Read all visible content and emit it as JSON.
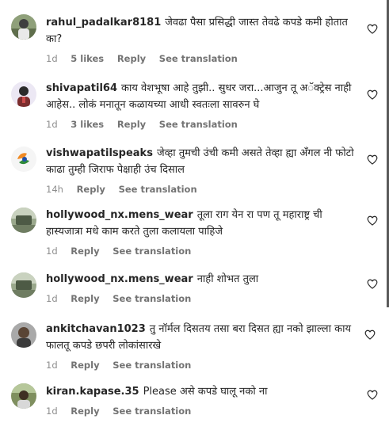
{
  "comments": [
    {
      "username": "rahul_padalkar8181",
      "text": "जेवढा पैसा प्रसिद्धी जास्त तेवढे कपडे कमी होतात का?",
      "time": "1d",
      "likes": "5 likes",
      "reply": "Reply",
      "translate": "See translation",
      "avatar_color": "#6b7b5a"
    },
    {
      "username": "shivapatil64",
      "text": "काय वेशभूषा आहे तुझी.. सुधर जरा...आजुन तू अॅक्ट्रेस नाही आहेस.. लोकं मनातून कळायच्या आधी स्वतःला सावरुन घे",
      "time": "1d",
      "likes": "3 likes",
      "reply": "Reply",
      "translate": "See translation",
      "avatar_color": "#e7e2f0"
    },
    {
      "username": "vishwapatilspeaks",
      "text": "जेव्हा तुमची उंची कमी असते तेव्हा ह्या अँगल नी फोटो काढा तुम्ही जिराफ पेक्षाही उंच दिसाल",
      "time": "14h",
      "likes": "",
      "reply": "Reply",
      "translate": "See translation",
      "avatar_color": "#f3f3f3"
    },
    {
      "username": "hollywood_nx.mens_wear",
      "text": "तूला राग येन रा पण तू महाराष्ट्र ची हास्यजात्रा मधे काम करते तुला कलायला पाहिजे",
      "time": "1d",
      "likes": "",
      "reply": "Reply",
      "translate": "See translation",
      "avatar_color": "#7a8a6e"
    },
    {
      "username": "hollywood_nx.mens_wear",
      "text": "नाही शोभत तुला",
      "time": "1d",
      "likes": "",
      "reply": "Reply",
      "translate": "See translation",
      "avatar_color": "#7a8a6e"
    },
    {
      "username": "ankitchavan1023",
      "text": "तु नॉर्मल दिसतय तसा बरा दिसत ह्या नको झाल्ला काय फालतू कपडे छपरी लोकांसारखे",
      "time": "1d",
      "likes": "",
      "reply": "Reply",
      "translate": "See translation",
      "avatar_color": "#8d8d8d"
    },
    {
      "username": "kiran.kapase.35",
      "text": "Please असे कपडे घालू नको ना",
      "time": "1d",
      "likes": "",
      "reply": "Reply",
      "translate": "See translation",
      "avatar_color": "#6f7f4f"
    }
  ]
}
